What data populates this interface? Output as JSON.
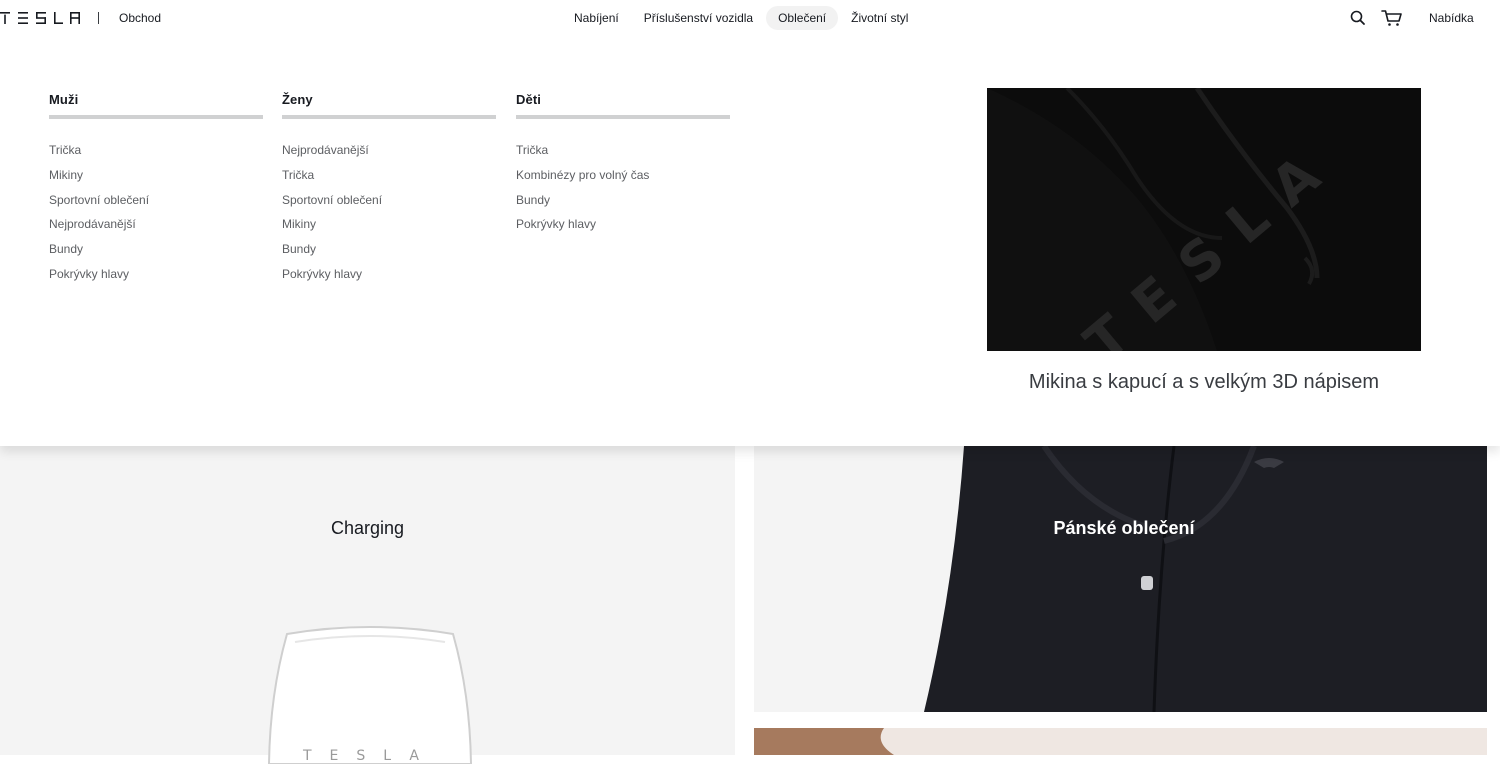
{
  "header": {
    "brand": "TESLA",
    "shop_link": "Obchod",
    "nav": [
      {
        "label": "Nabíjení"
      },
      {
        "label": "Příslušenství vozidla"
      },
      {
        "label": "Oblečení",
        "active": true
      },
      {
        "label": "Životní styl"
      }
    ],
    "search_icon": "search-icon",
    "cart_icon": "cart-icon",
    "menu_label": "Nabídka"
  },
  "mega_menu": {
    "columns": [
      {
        "title": "Muži",
        "items": [
          "Trička",
          "Mikiny",
          "Sportovní oblečení",
          "Nejprodávanější",
          "Bundy",
          "Pokrývky hlavy"
        ]
      },
      {
        "title": "Ženy",
        "items": [
          "Nejprodávanější",
          "Trička",
          "Sportovní oblečení",
          "Mikiny",
          "Bundy",
          "Pokrývky hlavy"
        ]
      },
      {
        "title": "Děti",
        "items": [
          "Trička",
          "Kombinézy pro volný čas",
          "Bundy",
          "Pokrývky hlavy"
        ]
      }
    ],
    "promo": {
      "image_letters": "TESLA",
      "caption": "Mikina s kapucí a s velkým 3D nápisem"
    }
  },
  "content": {
    "cards": [
      {
        "title": "Charging"
      },
      {
        "title": "Pánské oblečení"
      }
    ],
    "charger_lettering": "TESLA"
  },
  "colors": {
    "text": "#171a20",
    "muted": "#5c5e62",
    "active_bg": "#f2f2f2",
    "panel_bg": "#f4f4f4"
  }
}
